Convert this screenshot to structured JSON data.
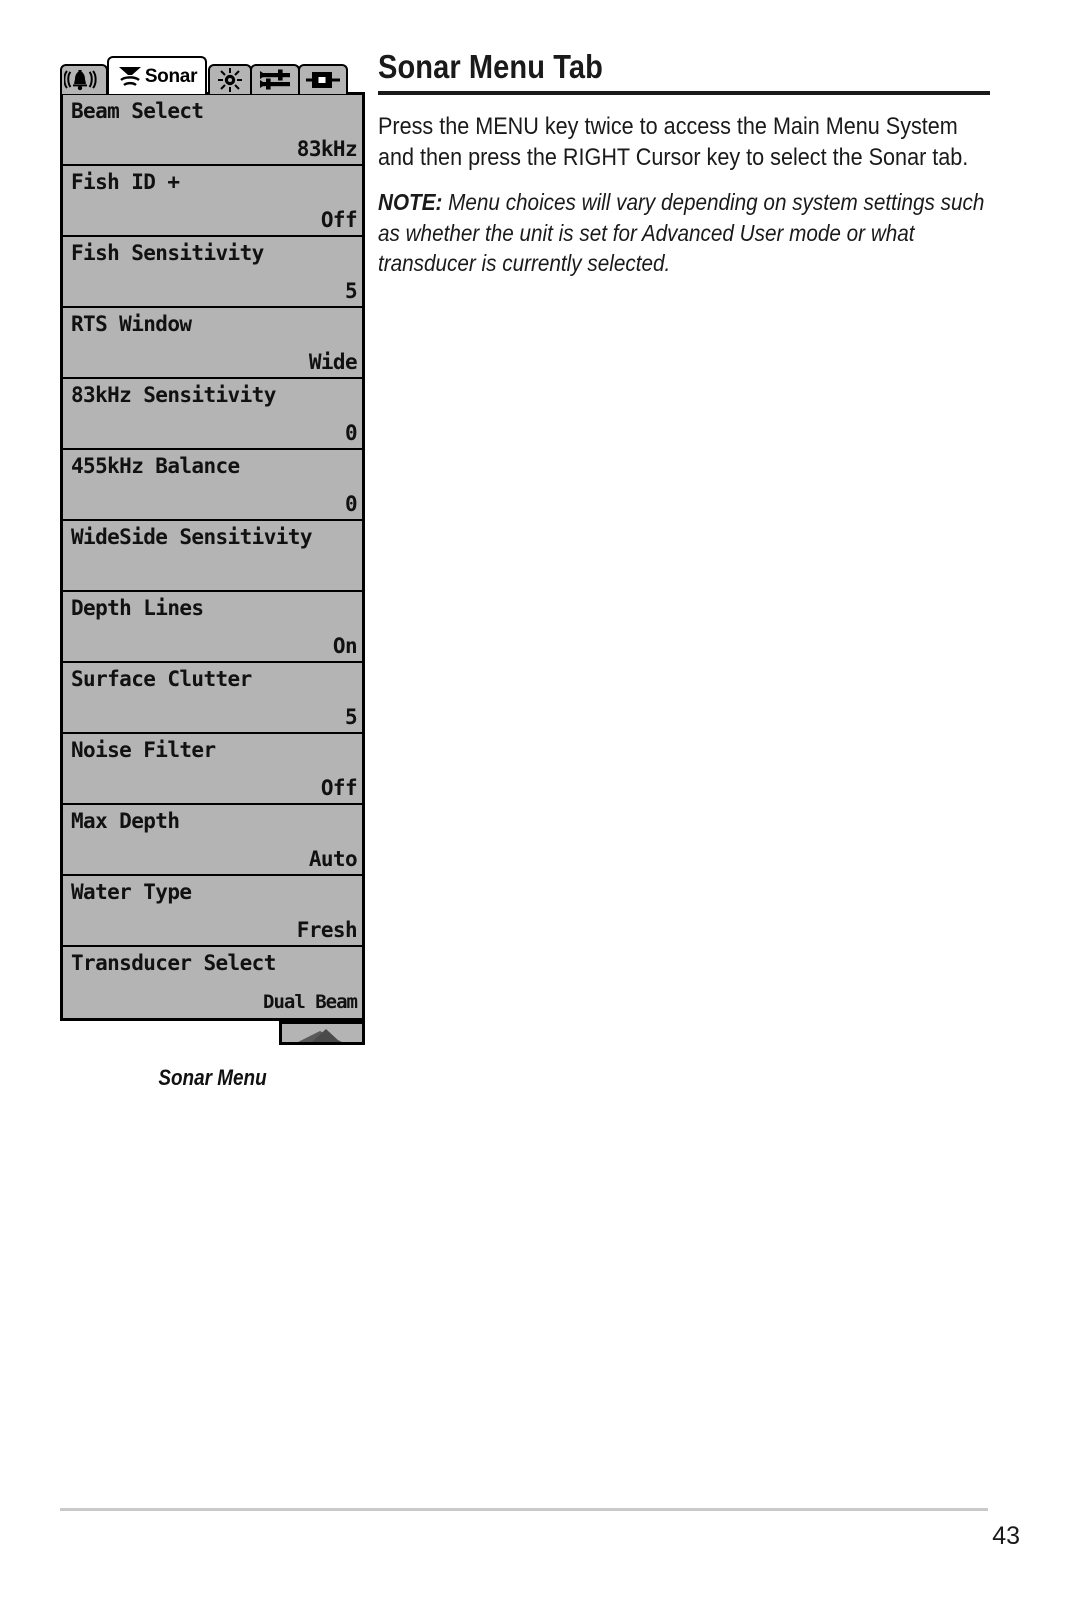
{
  "document": {
    "page_number": "43"
  },
  "article": {
    "title": "Sonar Menu Tab",
    "paragraph": "Press the MENU key twice to access the Main Menu System and then press the RIGHT Cursor key to select the Sonar tab.",
    "note_label": "NOTE:",
    "note_text": " Menu choices will vary depending on system settings such as whether the unit is set for Advanced User mode or what transducer is currently selected."
  },
  "figure": {
    "caption": "Sonar Menu",
    "screen": {
      "colors": {
        "background": "#b4b4b4",
        "border": "#000000",
        "active_tab": "#ffffff",
        "text": "#111111"
      },
      "tabs": [
        {
          "id": "alarms",
          "icon": "alarm-bell-icon",
          "label": "",
          "active": false
        },
        {
          "id": "sonar",
          "icon": "sonar-cone-icon",
          "label": "Sonar",
          "active": true
        },
        {
          "id": "setup",
          "icon": "brightness-sun-icon",
          "label": "",
          "active": false
        },
        {
          "id": "tools",
          "icon": "wrench-sliders-icon",
          "label": "",
          "active": false
        },
        {
          "id": "accessories",
          "icon": "accessory-box-icon",
          "label": "",
          "active": false
        }
      ],
      "menu_items": [
        {
          "label": "Beam Select",
          "value": "83kHz"
        },
        {
          "label": "Fish ID +",
          "value": "Off"
        },
        {
          "label": "Fish Sensitivity",
          "value": "5"
        },
        {
          "label": "RTS Window",
          "value": "Wide"
        },
        {
          "label": "83kHz Sensitivity",
          "value": "0"
        },
        {
          "label": "455kHz Balance",
          "value": "0"
        },
        {
          "label": "WideSide Sensitivity",
          "value": ""
        },
        {
          "label": "Depth Lines",
          "value": "On"
        },
        {
          "label": "Surface Clutter",
          "value": "5"
        },
        {
          "label": "Noise Filter",
          "value": "Off"
        },
        {
          "label": "Max Depth",
          "value": "Auto"
        },
        {
          "label": "Water Type",
          "value": "Fresh"
        },
        {
          "label": "Transducer Select",
          "value": "Dual Beam"
        }
      ],
      "scroll_indicator": "scroll-up-indicator"
    }
  }
}
